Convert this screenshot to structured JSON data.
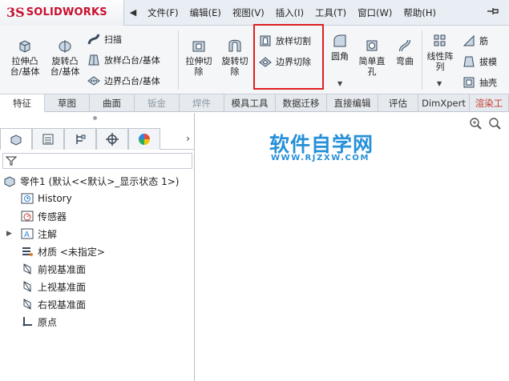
{
  "app": {
    "logo_ds": "3S",
    "logo_name": "SOLIDWORKS"
  },
  "menu": {
    "arrow": "◀",
    "items": [
      "文件(F)",
      "编辑(E)",
      "视图(V)",
      "插入(I)",
      "工具(T)",
      "窗口(W)",
      "帮助(H)"
    ],
    "pin_icon": "pin-icon"
  },
  "toolbar": {
    "extrude_boss": "拉伸凸\n台/基体",
    "revolve_boss": "旋转凸\n台/基体",
    "sweep": "扫描",
    "loft_boss": "放样凸台/基体",
    "boundary_boss": "边界凸台/基体",
    "extrude_cut": "拉伸切\n除",
    "revolve_cut": "旋转切\n除",
    "lofted_cut": "放样切割",
    "boundary_cut": "边界切除",
    "fillet": "圆角",
    "hole": "简单直\n孔",
    "flex": "弯曲",
    "linear_pattern": "线性阵\n列",
    "rib": "筋",
    "draft": "拔模",
    "shell": "抽壳"
  },
  "tabs": [
    "特征",
    "草图",
    "曲面",
    "钣金",
    "焊件",
    "模具工具",
    "数据迁移",
    "直接编辑",
    "评估",
    "DimXpert",
    "渲染工"
  ],
  "tree": {
    "root": "零件1  (默认<<默认>_显示状态 1>)",
    "items": [
      "History",
      "传感器",
      "注解",
      "材质 <未指定>",
      "前视基准面",
      "上视基准面",
      "右视基准面",
      "原点"
    ]
  },
  "watermark": {
    "title": "软件自学网",
    "url": "WWW.RJZXW.COM"
  },
  "colors": {
    "brand": "#c8102e",
    "highlight": "#e02020",
    "watermark": "#2690d8"
  }
}
